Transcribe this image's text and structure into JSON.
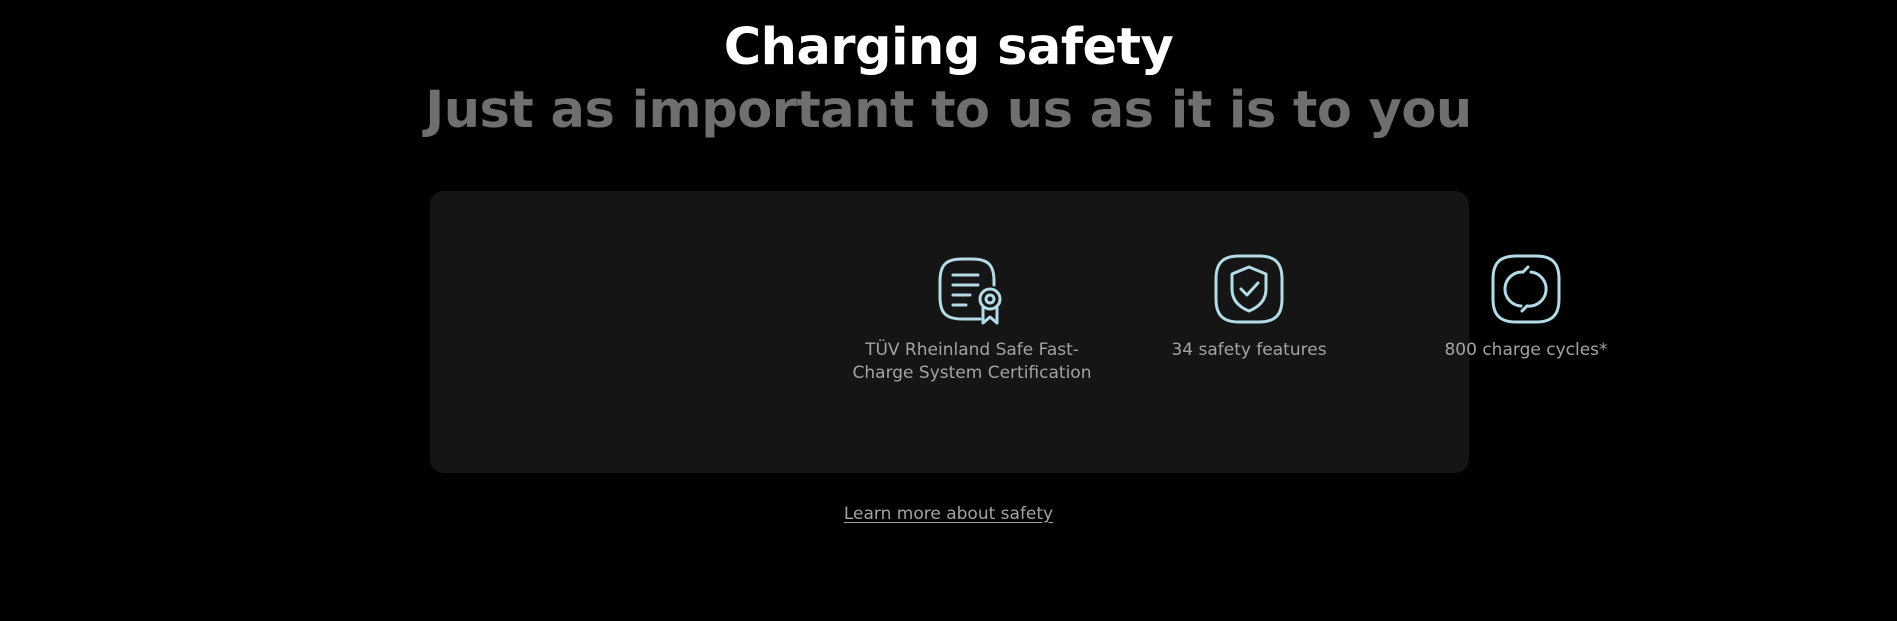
{
  "header": {
    "title": "Charging safety",
    "subtitle": "Just as important to us as it is to you"
  },
  "features": [
    {
      "icon": "certificate-ribbon-icon",
      "label": "TÜV Rheinland Safe Fast-Charge System Certification"
    },
    {
      "icon": "shield-check-icon",
      "label": "34 safety features"
    },
    {
      "icon": "charge-cycle-icon",
      "label": "800 charge cycles*"
    }
  ],
  "link": {
    "label": "Learn more about safety"
  },
  "colors": {
    "background": "#000000",
    "card": "#151515",
    "title": "#ffffff",
    "subtitle": "#6f6f6f",
    "text": "#a3a3a3",
    "icon_stroke": "#b4dbe8"
  }
}
